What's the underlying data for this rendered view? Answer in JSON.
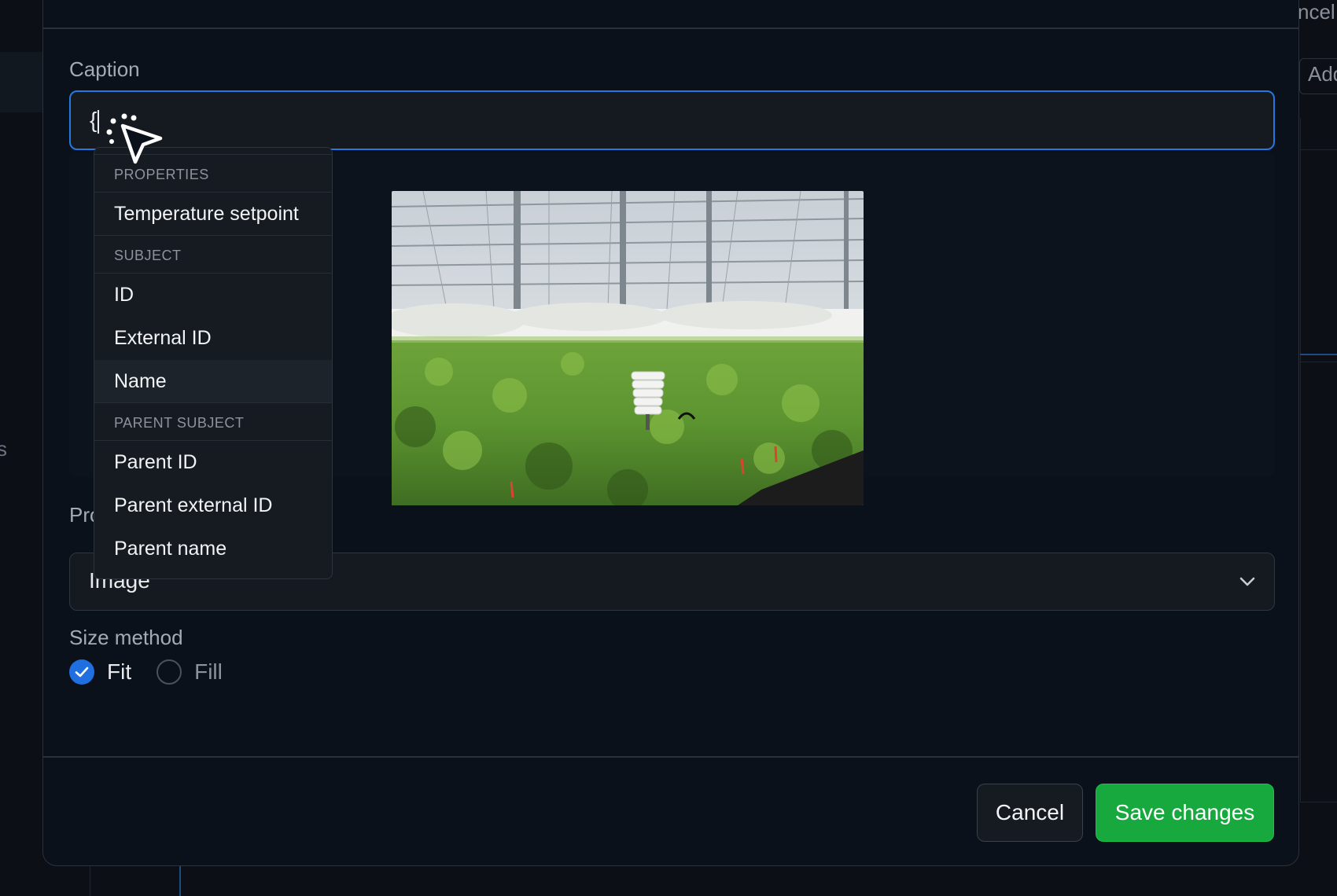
{
  "background": {
    "right_top_text": "ncel",
    "right_button_text": "Add",
    "left_letter": "s"
  },
  "form": {
    "caption_label": "Caption",
    "caption_value": "{",
    "property_label": "Pro",
    "property_value": "Image",
    "size_label": "Size method",
    "size_options": [
      {
        "label": "Fit",
        "checked": true
      },
      {
        "label": "Fill",
        "checked": false
      }
    ]
  },
  "dropdown": {
    "sections": [
      {
        "header": "PROPERTIES",
        "items": [
          "Temperature setpoint"
        ]
      },
      {
        "header": "SUBJECT",
        "items": [
          "ID",
          "External ID",
          "Name"
        ]
      },
      {
        "header": "PARENT SUBJECT",
        "items": [
          "Parent ID",
          "Parent external ID",
          "Parent name"
        ]
      }
    ],
    "highlighted_item": "Name"
  },
  "footer": {
    "cancel_label": "Cancel",
    "save_label": "Save changes"
  },
  "colors": {
    "accent": "#2578e0",
    "save": "#17a93e",
    "modal_bg": "#0b111a"
  },
  "icons": {
    "cursor": "click-cursor-icon",
    "chevron": "chevron-down-icon",
    "check": "checkmark-icon"
  }
}
